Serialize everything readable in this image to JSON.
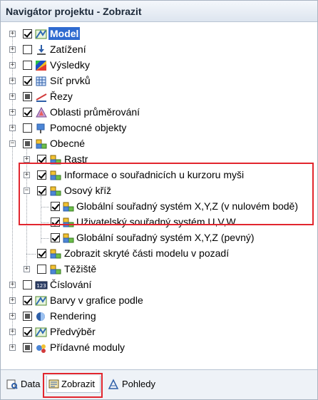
{
  "window": {
    "title": "Navigátor projektu - Zobrazit"
  },
  "tree": {
    "items": [
      {
        "label": "Model"
      },
      {
        "label": "Zatížení"
      },
      {
        "label": "Výsledky"
      },
      {
        "label": "Síť prvků"
      },
      {
        "label": "Řezy"
      },
      {
        "label": "Oblasti průměrování"
      },
      {
        "label": "Pomocné objekty"
      },
      {
        "label": "Obecné"
      },
      {
        "label": "Rastr"
      },
      {
        "label": "Informace o souřadnicích u kurzoru myši"
      },
      {
        "label": "Osový kříž"
      },
      {
        "label": "Globální souřadný systém X,Y,Z (v nulovém bodě)"
      },
      {
        "label": "Uživatelský souřadný systém U,V,W"
      },
      {
        "label": "Globální souřadný systém X,Y,Z (pevný)"
      },
      {
        "label": "Zobrazit skryté části modelu v pozadí"
      },
      {
        "label": "Těžiště"
      },
      {
        "label": "Číslování"
      },
      {
        "label": "Barvy v grafice podle"
      },
      {
        "label": "Rendering"
      },
      {
        "label": "Předvýběr"
      },
      {
        "label": "Přídavné moduly"
      }
    ]
  },
  "tabs": [
    {
      "label": "Data"
    },
    {
      "label": "Zobrazit"
    },
    {
      "label": "Pohledy"
    }
  ],
  "colors": {
    "selection": "#2f6bd0",
    "highlight": "#e2262e"
  }
}
